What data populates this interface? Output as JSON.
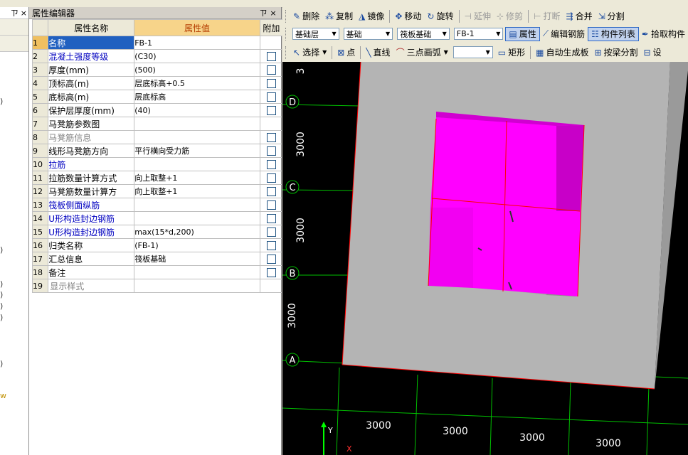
{
  "left_panel": {
    "title_icons": [
      "pin-icon",
      "close-icon"
    ],
    "markers": [
      ")",
      ")",
      ")",
      ")",
      ")",
      ")",
      ")",
      "w"
    ]
  },
  "property_editor": {
    "title": "属性编辑器",
    "columns": {
      "name": "属性名称",
      "value": "属性值",
      "extra": "附加"
    },
    "rows": [
      {
        "num": "1",
        "name": "名称",
        "value": "FB-1",
        "checkbox": false,
        "style": "selected"
      },
      {
        "num": "2",
        "name": "混凝土强度等级",
        "value": "(C30)",
        "checkbox": true,
        "style": "blue"
      },
      {
        "num": "3",
        "name": "厚度(mm)",
        "value": "(500)",
        "checkbox": true,
        "style": "normal"
      },
      {
        "num": "4",
        "name": "顶标高(m)",
        "value": "层底标高+0.5",
        "checkbox": true,
        "style": "normal"
      },
      {
        "num": "5",
        "name": "底标高(m)",
        "value": "层底标高",
        "checkbox": true,
        "style": "normal"
      },
      {
        "num": "6",
        "name": "保护层厚度(mm)",
        "value": "(40)",
        "checkbox": true,
        "style": "normal"
      },
      {
        "num": "7",
        "name": "马凳筋参数图",
        "value": "",
        "checkbox": false,
        "style": "normal"
      },
      {
        "num": "8",
        "name": "马凳筋信息",
        "value": "",
        "checkbox": true,
        "style": "gray"
      },
      {
        "num": "9",
        "name": "线形马凳筋方向",
        "value": "平行横向受力筋",
        "checkbox": true,
        "style": "normal"
      },
      {
        "num": "10",
        "name": "拉筋",
        "value": "",
        "checkbox": true,
        "style": "blue"
      },
      {
        "num": "11",
        "name": "拉筋数量计算方式",
        "value": "向上取整+1",
        "checkbox": true,
        "style": "normal"
      },
      {
        "num": "12",
        "name": "马凳筋数量计算方",
        "value": "向上取整+1",
        "checkbox": true,
        "style": "normal"
      },
      {
        "num": "13",
        "name": "筏板侧面纵筋",
        "value": "",
        "checkbox": true,
        "style": "blue"
      },
      {
        "num": "14",
        "name": "U形构造封边钢筋",
        "value": "",
        "checkbox": true,
        "style": "blue"
      },
      {
        "num": "15",
        "name": "U形构造封边钢筋",
        "value": "max(15*d,200)",
        "checkbox": true,
        "style": "blue"
      },
      {
        "num": "16",
        "name": "归类名称",
        "value": "(FB-1)",
        "checkbox": true,
        "style": "normal"
      },
      {
        "num": "17",
        "name": "汇总信息",
        "value": "筏板基础",
        "checkbox": true,
        "style": "normal"
      },
      {
        "num": "18",
        "name": "备注",
        "value": "",
        "checkbox": true,
        "style": "normal"
      },
      {
        "num": "19",
        "name": "显示样式",
        "value": "",
        "checkbox": false,
        "style": "gray-expand"
      }
    ]
  },
  "toolbar": {
    "row1": {
      "delete": "删除",
      "copy": "复制",
      "mirror": "镜像",
      "move": "移动",
      "rotate": "旋转",
      "extend": "延伸",
      "trim": "修剪",
      "break": "打断",
      "merge": "合并",
      "split": "分割"
    },
    "row2": {
      "layer": "基础层",
      "category": "基础",
      "type": "筏板基础",
      "component": "FB-1",
      "properties": "属性",
      "edit_rebar": "编辑钢筋",
      "component_list": "构件列表",
      "pick_component": "拾取构件"
    },
    "row3": {
      "select": "选择",
      "point": "点",
      "line": "直线",
      "arc": "三点画弧",
      "blank": "",
      "rect": "矩形",
      "auto_slab": "自动生成板",
      "split_by_beam": "按梁分割",
      "set": "设"
    }
  },
  "viewport": {
    "axis_labels_letters": [
      "D",
      "C",
      "B",
      "A"
    ],
    "axis_labels_dims_vertical": [
      "3000",
      "3000",
      "3000"
    ],
    "axis_labels_top": "3",
    "axis_labels_dims_horizontal": [
      "3000",
      "3000",
      "3000",
      "3000"
    ],
    "triad": {
      "y": "Y",
      "x": "X"
    },
    "colors": {
      "slab": "#b4b4b4",
      "magenta": "#ff00ff",
      "grid": "#00c000",
      "axis_red": "#ff0000",
      "bg": "#000000"
    }
  }
}
